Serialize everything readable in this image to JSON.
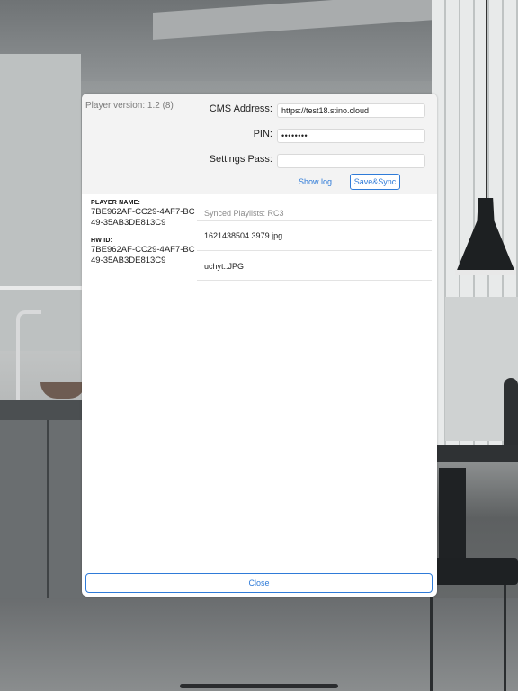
{
  "dialog": {
    "version_text": "Player version: 1.2 (8)",
    "cms_label": "CMS Address:",
    "cms_value": "https://test18.stino.cloud",
    "pin_label": "PIN:",
    "pin_value": "••••••••",
    "settings_label": "Settings Pass:",
    "settings_value": "",
    "show_log_label": "Show log",
    "save_sync_label": "Save&Sync",
    "close_label": "Close",
    "accent_color": "#2f7bd8"
  },
  "info": {
    "player_name_label": "PLAYER NAME:",
    "player_name_value": "7BE962AF-CC29-4AF7-BC49-35AB3DE813C9",
    "hw_id_label": "HW ID:",
    "hw_id_value": "7BE962AF-CC29-4AF7-BC49-35AB3DE813C9"
  },
  "playlists": {
    "header": "Synced Playlists: RC3",
    "items": [
      {
        "name": "1621438504.3979.jpg"
      },
      {
        "name": "uchyt..JPG"
      }
    ]
  }
}
